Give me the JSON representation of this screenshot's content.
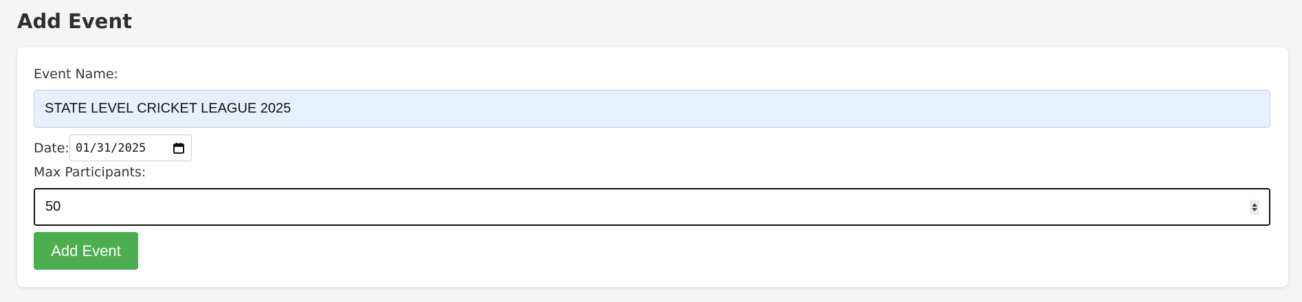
{
  "page": {
    "title": "Add Event"
  },
  "form": {
    "event_name": {
      "label": "Event Name:",
      "value": "STATE LEVEL CRICKET LEAGUE 2025"
    },
    "date": {
      "label": "Date:",
      "value": "01/31/2025",
      "icon": "calendar-icon"
    },
    "max_participants": {
      "label": "Max Participants:",
      "value": "50",
      "icon": "spinner-icon"
    },
    "submit_label": "Add Event"
  },
  "colors": {
    "background": "#f4f5f4",
    "card": "#ffffff",
    "autofill_input": "#e8f0fe",
    "button": "#4cae4f",
    "button_text": "#ffffff"
  }
}
